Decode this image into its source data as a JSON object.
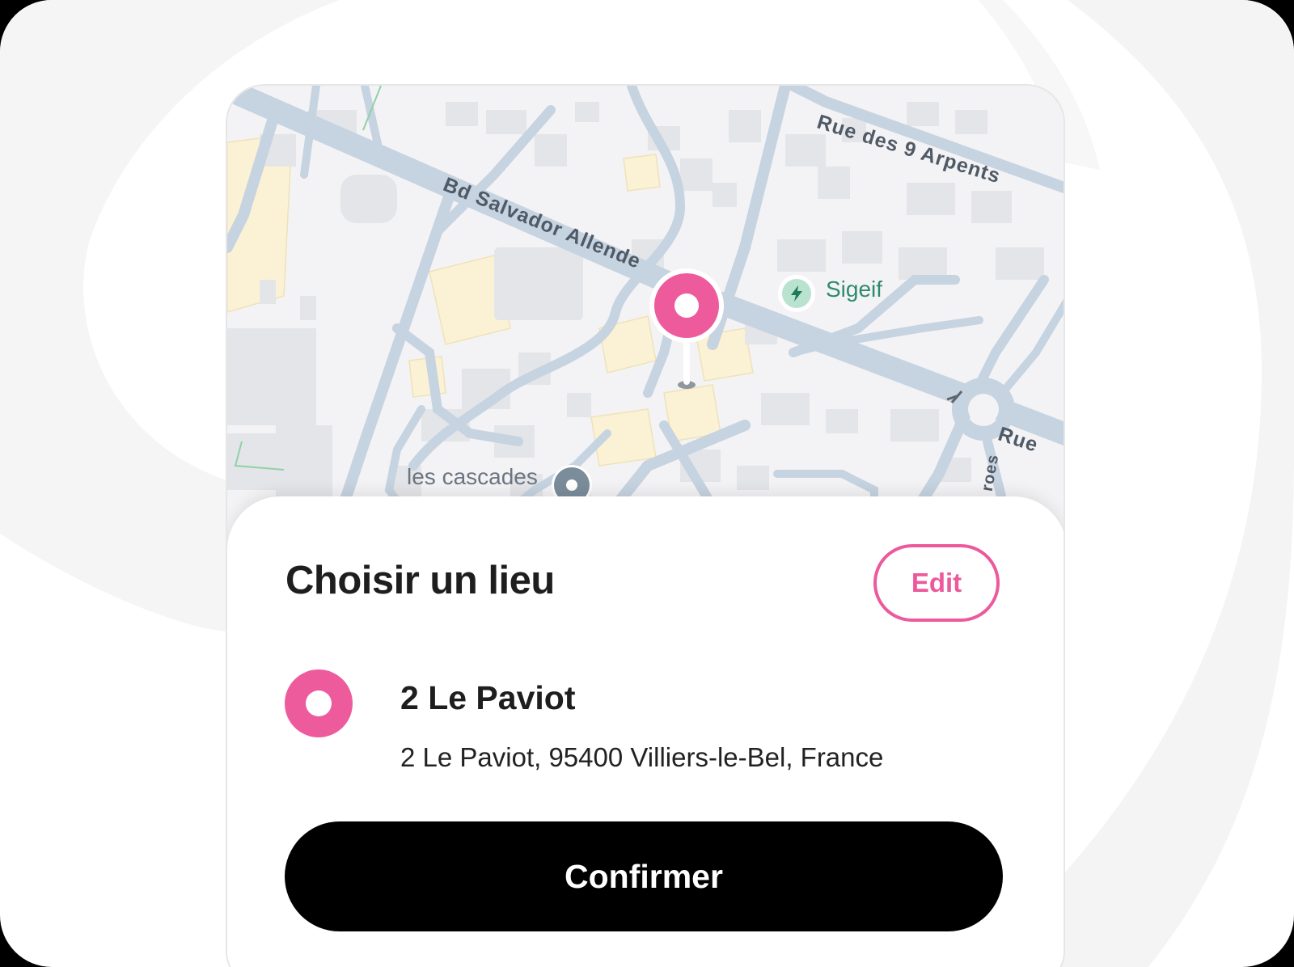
{
  "map": {
    "street_labels": [
      "Bd Salvador Allende",
      "Rue des 9 Arpents",
      "Rue",
      "roes"
    ],
    "poi_sigeif": "Sigeif",
    "poi_cascades": "les cascades",
    "pin_color": "#ee5b9d"
  },
  "sheet": {
    "title": "Choisir un lieu",
    "edit_label": "Edit",
    "location_name": "2 Le Paviot",
    "location_address": "2 Le Paviot, 95400 Villiers-le-Bel, France",
    "confirm_label": "Confirmer"
  },
  "colors": {
    "accent": "#ec5a9c",
    "button": "#000000"
  },
  "icons": {
    "map_pin": "map-pin-icon",
    "location": "location-pin-icon",
    "charging": "lightning-icon",
    "poi": "poi-dot-icon",
    "direction": "arrow-icon"
  }
}
